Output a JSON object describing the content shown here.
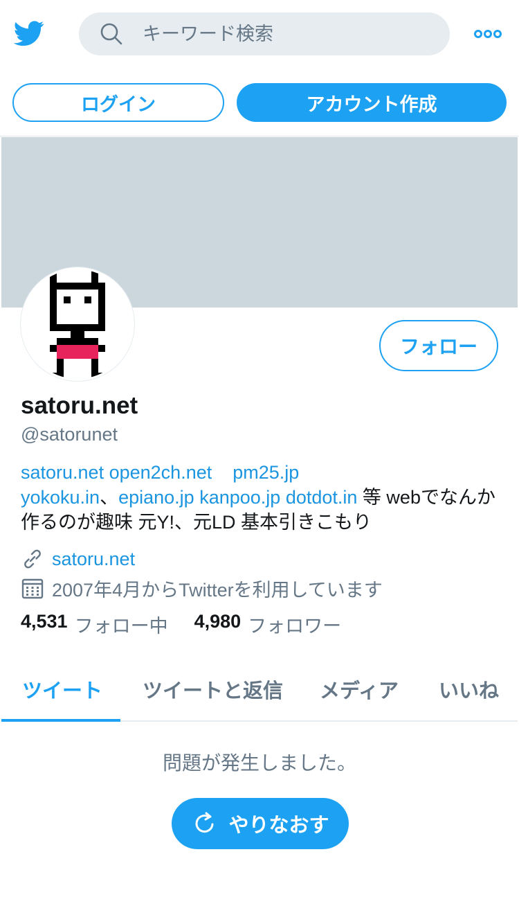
{
  "search": {
    "placeholder": "キーワード検索"
  },
  "auth": {
    "login_label": "ログイン",
    "signup_label": "アカウント作成"
  },
  "profile": {
    "follow_label": "フォロー",
    "name": "satoru.net",
    "handle": "@satorunet",
    "bio": {
      "link1": "satoru.net",
      "link2": "open2ch.net",
      "link3": "pm25.jp",
      "link4": "yokoku.in",
      "sep1": "、",
      "link5": "epiano.jp",
      "link6": "kanpoo.jp",
      "link7": "dotdot.in",
      "text": " 等 webでなんか作るのが趣味 元Y!、元LD 基本引きこもり"
    },
    "website": "satoru.net",
    "joined": "2007年4月からTwitterを利用しています",
    "following_count": "4,531",
    "following_label": "フォロー中",
    "followers_count": "4,980",
    "followers_label": "フォロワー"
  },
  "tabs": [
    {
      "label": "ツイート",
      "active": true
    },
    {
      "label": "ツイートと返信",
      "active": false
    },
    {
      "label": "メディア",
      "active": false
    },
    {
      "label": "いいね",
      "active": false
    }
  ],
  "feed": {
    "error_message": "問題が発生しました。",
    "retry_label": "やりなおす"
  },
  "colors": {
    "accent": "#1da1f2",
    "link": "#1b95e0",
    "muted": "#657786",
    "banner": "#ccd6dd"
  }
}
